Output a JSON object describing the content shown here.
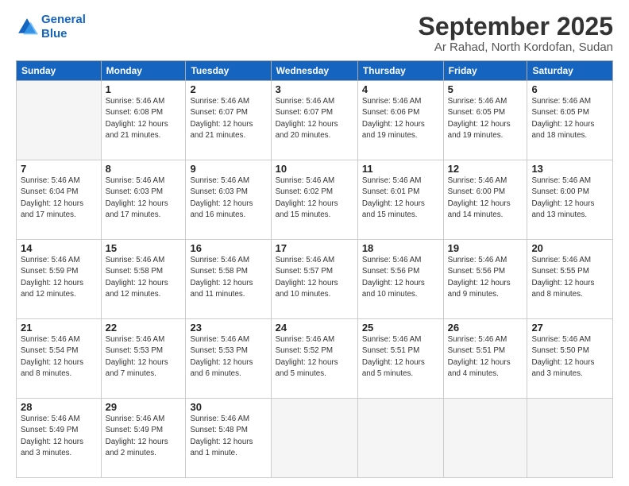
{
  "logo": {
    "line1": "General",
    "line2": "Blue"
  },
  "title": "September 2025",
  "subtitle": "Ar Rahad, North Kordofan, Sudan",
  "days_of_week": [
    "Sunday",
    "Monday",
    "Tuesday",
    "Wednesday",
    "Thursday",
    "Friday",
    "Saturday"
  ],
  "weeks": [
    [
      {
        "num": "",
        "info": ""
      },
      {
        "num": "1",
        "info": "Sunrise: 5:46 AM\nSunset: 6:08 PM\nDaylight: 12 hours\nand 21 minutes."
      },
      {
        "num": "2",
        "info": "Sunrise: 5:46 AM\nSunset: 6:07 PM\nDaylight: 12 hours\nand 21 minutes."
      },
      {
        "num": "3",
        "info": "Sunrise: 5:46 AM\nSunset: 6:07 PM\nDaylight: 12 hours\nand 20 minutes."
      },
      {
        "num": "4",
        "info": "Sunrise: 5:46 AM\nSunset: 6:06 PM\nDaylight: 12 hours\nand 19 minutes."
      },
      {
        "num": "5",
        "info": "Sunrise: 5:46 AM\nSunset: 6:05 PM\nDaylight: 12 hours\nand 19 minutes."
      },
      {
        "num": "6",
        "info": "Sunrise: 5:46 AM\nSunset: 6:05 PM\nDaylight: 12 hours\nand 18 minutes."
      }
    ],
    [
      {
        "num": "7",
        "info": "Sunrise: 5:46 AM\nSunset: 6:04 PM\nDaylight: 12 hours\nand 17 minutes."
      },
      {
        "num": "8",
        "info": "Sunrise: 5:46 AM\nSunset: 6:03 PM\nDaylight: 12 hours\nand 17 minutes."
      },
      {
        "num": "9",
        "info": "Sunrise: 5:46 AM\nSunset: 6:03 PM\nDaylight: 12 hours\nand 16 minutes."
      },
      {
        "num": "10",
        "info": "Sunrise: 5:46 AM\nSunset: 6:02 PM\nDaylight: 12 hours\nand 15 minutes."
      },
      {
        "num": "11",
        "info": "Sunrise: 5:46 AM\nSunset: 6:01 PM\nDaylight: 12 hours\nand 15 minutes."
      },
      {
        "num": "12",
        "info": "Sunrise: 5:46 AM\nSunset: 6:00 PM\nDaylight: 12 hours\nand 14 minutes."
      },
      {
        "num": "13",
        "info": "Sunrise: 5:46 AM\nSunset: 6:00 PM\nDaylight: 12 hours\nand 13 minutes."
      }
    ],
    [
      {
        "num": "14",
        "info": "Sunrise: 5:46 AM\nSunset: 5:59 PM\nDaylight: 12 hours\nand 12 minutes."
      },
      {
        "num": "15",
        "info": "Sunrise: 5:46 AM\nSunset: 5:58 PM\nDaylight: 12 hours\nand 12 minutes."
      },
      {
        "num": "16",
        "info": "Sunrise: 5:46 AM\nSunset: 5:58 PM\nDaylight: 12 hours\nand 11 minutes."
      },
      {
        "num": "17",
        "info": "Sunrise: 5:46 AM\nSunset: 5:57 PM\nDaylight: 12 hours\nand 10 minutes."
      },
      {
        "num": "18",
        "info": "Sunrise: 5:46 AM\nSunset: 5:56 PM\nDaylight: 12 hours\nand 10 minutes."
      },
      {
        "num": "19",
        "info": "Sunrise: 5:46 AM\nSunset: 5:56 PM\nDaylight: 12 hours\nand 9 minutes."
      },
      {
        "num": "20",
        "info": "Sunrise: 5:46 AM\nSunset: 5:55 PM\nDaylight: 12 hours\nand 8 minutes."
      }
    ],
    [
      {
        "num": "21",
        "info": "Sunrise: 5:46 AM\nSunset: 5:54 PM\nDaylight: 12 hours\nand 8 minutes."
      },
      {
        "num": "22",
        "info": "Sunrise: 5:46 AM\nSunset: 5:53 PM\nDaylight: 12 hours\nand 7 minutes."
      },
      {
        "num": "23",
        "info": "Sunrise: 5:46 AM\nSunset: 5:53 PM\nDaylight: 12 hours\nand 6 minutes."
      },
      {
        "num": "24",
        "info": "Sunrise: 5:46 AM\nSunset: 5:52 PM\nDaylight: 12 hours\nand 5 minutes."
      },
      {
        "num": "25",
        "info": "Sunrise: 5:46 AM\nSunset: 5:51 PM\nDaylight: 12 hours\nand 5 minutes."
      },
      {
        "num": "26",
        "info": "Sunrise: 5:46 AM\nSunset: 5:51 PM\nDaylight: 12 hours\nand 4 minutes."
      },
      {
        "num": "27",
        "info": "Sunrise: 5:46 AM\nSunset: 5:50 PM\nDaylight: 12 hours\nand 3 minutes."
      }
    ],
    [
      {
        "num": "28",
        "info": "Sunrise: 5:46 AM\nSunset: 5:49 PM\nDaylight: 12 hours\nand 3 minutes."
      },
      {
        "num": "29",
        "info": "Sunrise: 5:46 AM\nSunset: 5:49 PM\nDaylight: 12 hours\nand 2 minutes."
      },
      {
        "num": "30",
        "info": "Sunrise: 5:46 AM\nSunset: 5:48 PM\nDaylight: 12 hours\nand 1 minute."
      },
      {
        "num": "",
        "info": ""
      },
      {
        "num": "",
        "info": ""
      },
      {
        "num": "",
        "info": ""
      },
      {
        "num": "",
        "info": ""
      }
    ]
  ]
}
